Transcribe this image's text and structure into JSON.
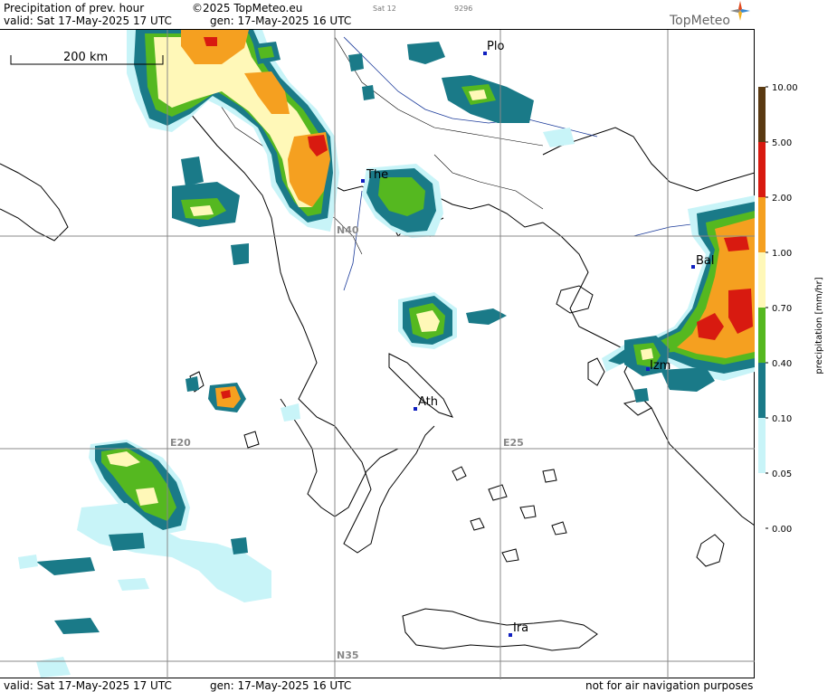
{
  "header": {
    "title": "Precipitation of prev. hour",
    "copyright": "©2025 TopMeteo.eu",
    "sat": "Sat 12",
    "code": "9296",
    "valid": "valid:  Sat  17-May-2025  17 UTC",
    "gen": "gen: 17-May-2025 16 UTC",
    "logo": "TopMeteo"
  },
  "footer": {
    "valid": "valid:  Sat  17-May-2025  17 UTC",
    "gen": "gen: 17-May-2025 16 UTC",
    "disclaimer": "not for air navigation purposes"
  },
  "map": {
    "scale_label": "200 km",
    "grid_labels": {
      "lat40": "N40",
      "lat35": "N35",
      "lon20": "E20",
      "lon25": "E25"
    },
    "cities": [
      {
        "id": "plo",
        "label": "Plo"
      },
      {
        "id": "the",
        "label": "The"
      },
      {
        "id": "bal",
        "label": "Bal"
      },
      {
        "id": "izm",
        "label": "Izm"
      },
      {
        "id": "ath",
        "label": "Ath"
      },
      {
        "id": "ira",
        "label": "Ira"
      }
    ]
  },
  "legend": {
    "title": "precipitation [mm/hr]",
    "levels": [
      {
        "value": "10.00",
        "color": "#5a3a12"
      },
      {
        "value": "5.00",
        "color": "#d81a10"
      },
      {
        "value": "2.00",
        "color": "#f5a020"
      },
      {
        "value": "1.00",
        "color": "#fff8b8"
      },
      {
        "value": "0.70",
        "color": "#55b820"
      },
      {
        "value": "0.40",
        "color": "#1a7a88"
      },
      {
        "value": "0.10",
        "color": "#c8f4f8"
      },
      {
        "value": "0.05",
        "color": "#ffffff"
      },
      {
        "value": "0.00",
        "color": "#ffffff"
      }
    ]
  }
}
